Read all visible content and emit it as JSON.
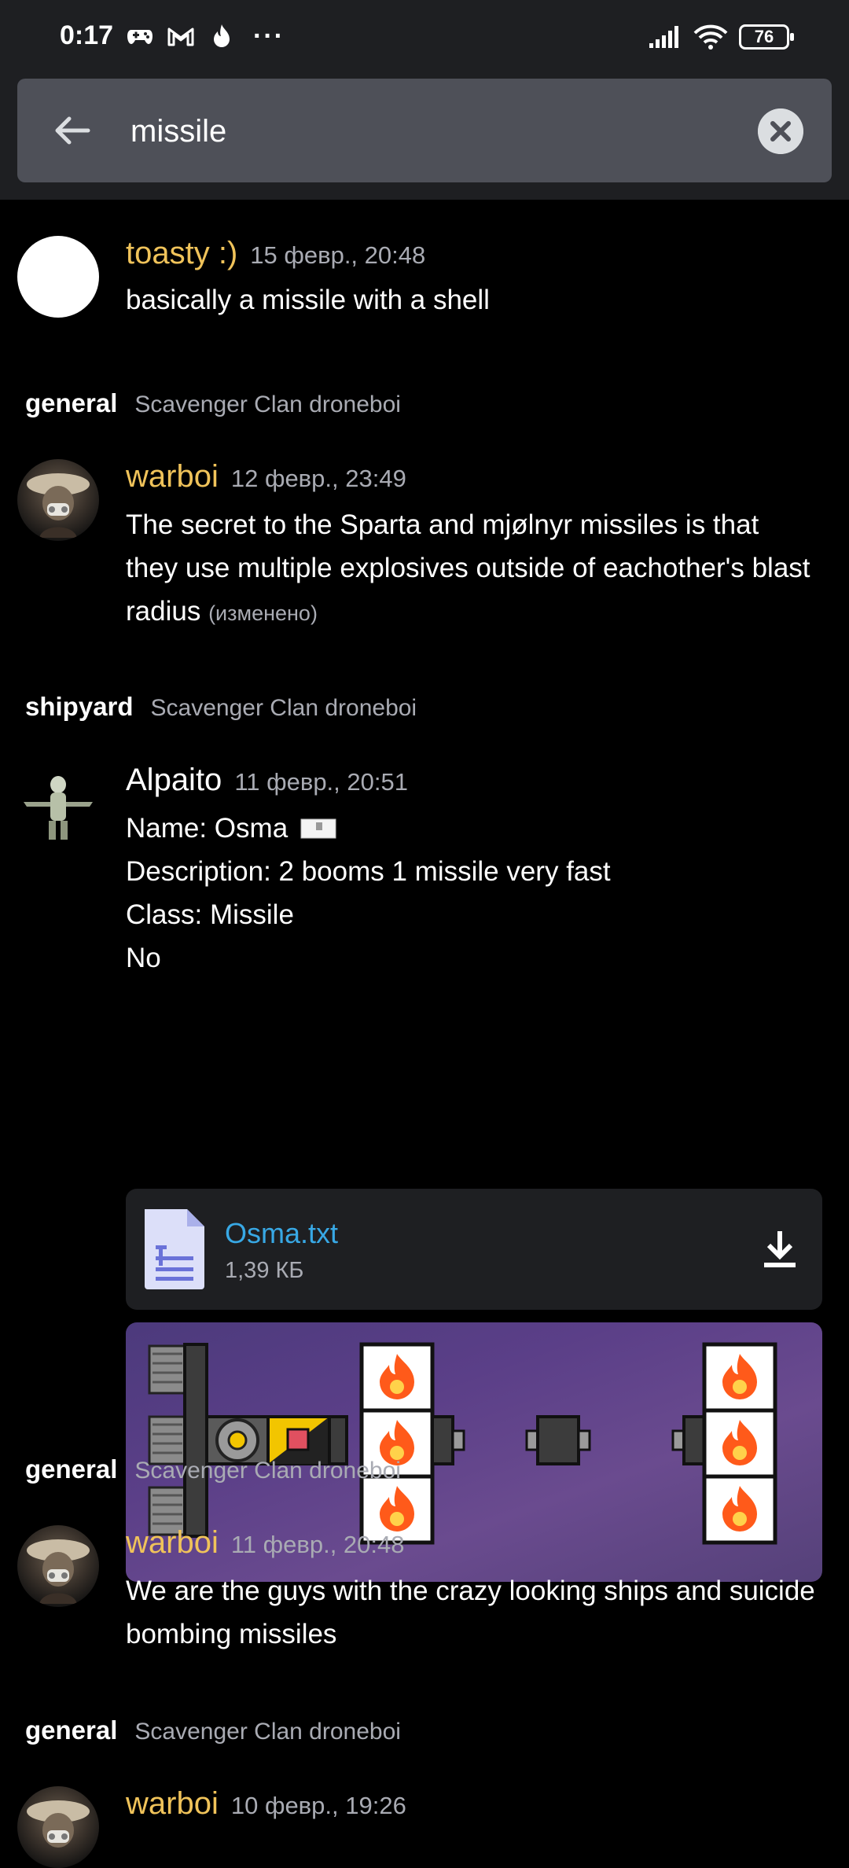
{
  "status_bar": {
    "time": "0:17",
    "battery": "76",
    "icons": [
      "gamepad-icon",
      "gmail-icon",
      "fire-icon",
      "more-icon",
      "signal-icon",
      "wifi-icon",
      "battery-icon"
    ],
    "dots": "···"
  },
  "search": {
    "query": "missile",
    "back_icon": "arrow-left-icon",
    "clear_icon": "clear-icon"
  },
  "colors": {
    "background": "#000000",
    "header": "#1e1f22",
    "search_field": "#4e5058",
    "author_gold": "#f0c35a",
    "author_white": "#ffffff",
    "link_blue": "#38a8e5",
    "muted": "#a9abb3"
  },
  "results": [
    {
      "author": "toasty :)",
      "timestamp": "15 февр., 20:48",
      "text": "basically a missile with a shell"
    },
    {
      "channel": "general",
      "guild": "Scavenger Clan droneboi",
      "author": "warboi",
      "timestamp": "12 февр., 23:49",
      "lines": [
        "The secret to the Sparta and mjølnyr missiles is that",
        "they use multiple explosives outside of eachother's blast",
        "radius"
      ],
      "edited": "(изменено)"
    },
    {
      "channel": "shipyard",
      "guild": "Scavenger Clan droneboi",
      "author": "Alpaito",
      "timestamp": "11 февр., 20:51",
      "lines": [
        "Name: Osma",
        "Description: 2 booms 1 missile very fast",
        "Class: Missile",
        "No"
      ],
      "attachment": {
        "name": "Osma.txt",
        "size": "1,39 КБ",
        "icon": "text-file-icon",
        "action_icon": "download-icon"
      }
    },
    {
      "channel": "general",
      "guild": "Scavenger Clan droneboi",
      "author": "warboi",
      "timestamp": "11 февр., 20:48",
      "lines": [
        "We are the guys with the crazy looking ships and suicide",
        "bombing missiles"
      ]
    },
    {
      "channel": "general",
      "guild": "Scavenger Clan droneboi",
      "author": "warboi",
      "timestamp": "10 февр., 19:26"
    }
  ]
}
